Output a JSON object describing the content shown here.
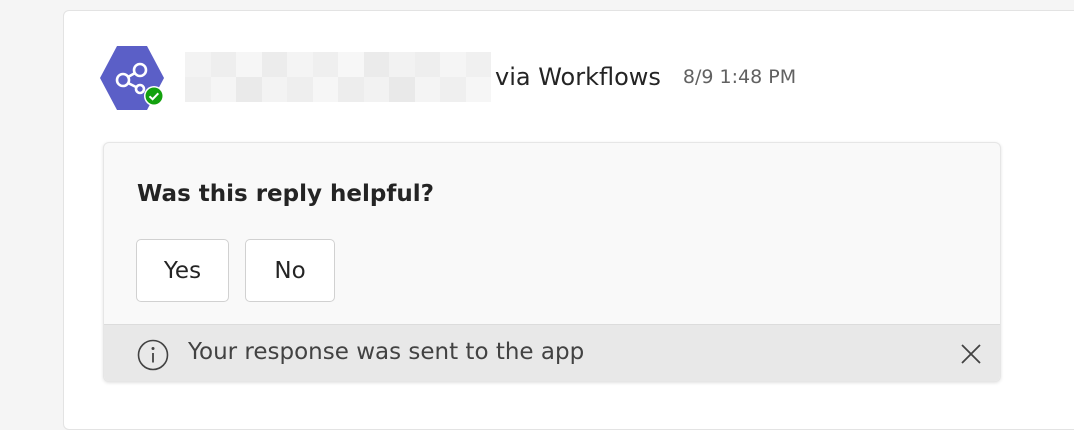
{
  "message": {
    "via_label": "via Workflows",
    "timestamp": "8/9 1:48 PM",
    "avatar_icon": "workflows-share-icon",
    "avatar_color": "#5b5fc7",
    "presence_icon": "available-check-icon",
    "presence_color": "#13a10e"
  },
  "card": {
    "question": "Was this reply helpful?",
    "buttons": [
      {
        "label": "Yes"
      },
      {
        "label": "No"
      }
    ],
    "response_bar": {
      "icon": "info-icon",
      "text": "Your response was sent to the app",
      "close_icon": "close-icon"
    }
  }
}
